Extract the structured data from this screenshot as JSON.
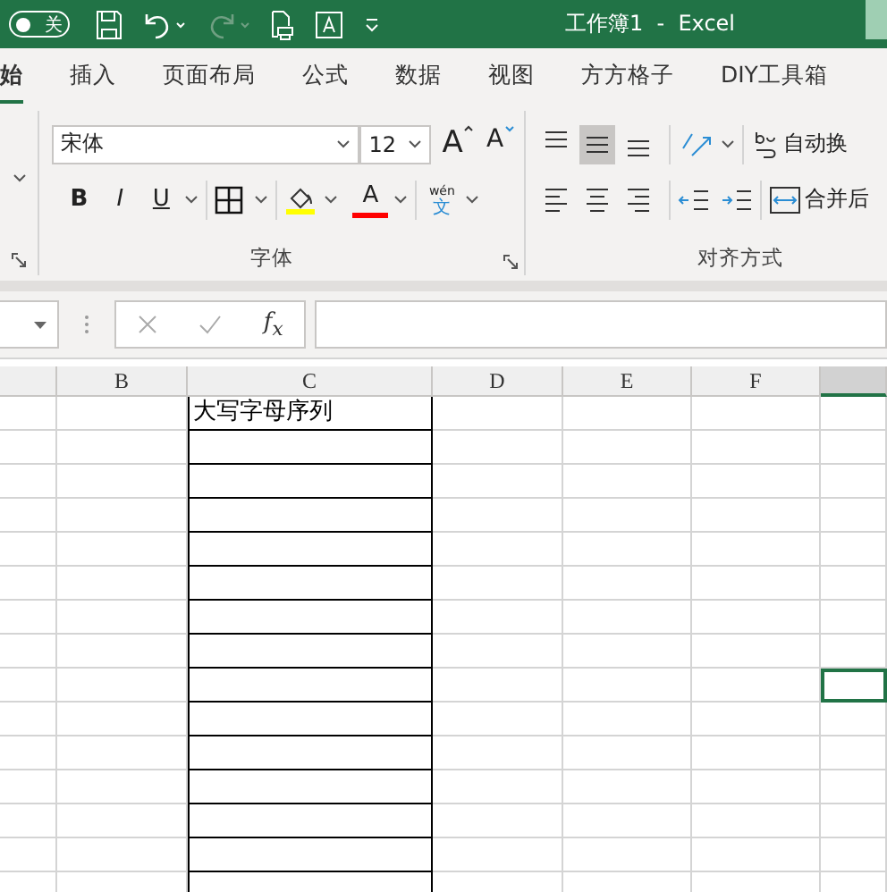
{
  "title_bar": {
    "autosave": {
      "label": "关",
      "on": false
    },
    "title": "工作簿1  -  Excel"
  },
  "tabs": [
    {
      "label": "始",
      "selected": true
    },
    {
      "label": "插入",
      "selected": false
    },
    {
      "label": "页面布局",
      "selected": false
    },
    {
      "label": "公式",
      "selected": false
    },
    {
      "label": "数据",
      "selected": false
    },
    {
      "label": "视图",
      "selected": false
    },
    {
      "label": "方方格子",
      "selected": false
    },
    {
      "label": "DIY工具箱",
      "selected": false
    }
  ],
  "font_group": {
    "font_name": "宋体",
    "font_size": "12",
    "grow": "A",
    "shrink": "A",
    "bold": "B",
    "italic": "I",
    "underline": "U",
    "font_color": "A",
    "phonetic_top": "wén",
    "phonetic_bottom": "文",
    "label": "字体"
  },
  "alignment_group": {
    "vertical": [
      {
        "selected": false
      },
      {
        "selected": true
      },
      {
        "selected": false
      }
    ],
    "wrap_text": "自动换",
    "merge": "合并后",
    "label": "对齐方式"
  },
  "formula_bar": {
    "fx": "f$_{x}$"
  },
  "sheet": {
    "columns": [
      {
        "selected": false
      },
      {
        "header": "B",
        "selected": false
      },
      {
        "header": "C",
        "selected": false,
        "bordered": true,
        "cells": [
          "大写字母序列"
        ]
      },
      {
        "header": "D",
        "selected": false
      },
      {
        "header": "E",
        "selected": false
      },
      {
        "header": "F",
        "selected": false
      },
      {
        "selected": true
      }
    ],
    "rows": [
      {
        "selected": false
      },
      {
        "selected": false
      },
      {
        "selected": false
      },
      {
        "selected": false
      },
      {
        "selected": false
      },
      {
        "selected": false
      },
      {
        "selected": false
      },
      {
        "selected": false
      },
      {
        "selected": true
      },
      {
        "selected": false
      },
      {
        "selected": false
      },
      {
        "selected": false
      },
      {
        "selected": false
      },
      {
        "selected": false
      },
      {
        "selected": false
      }
    ]
  }
}
